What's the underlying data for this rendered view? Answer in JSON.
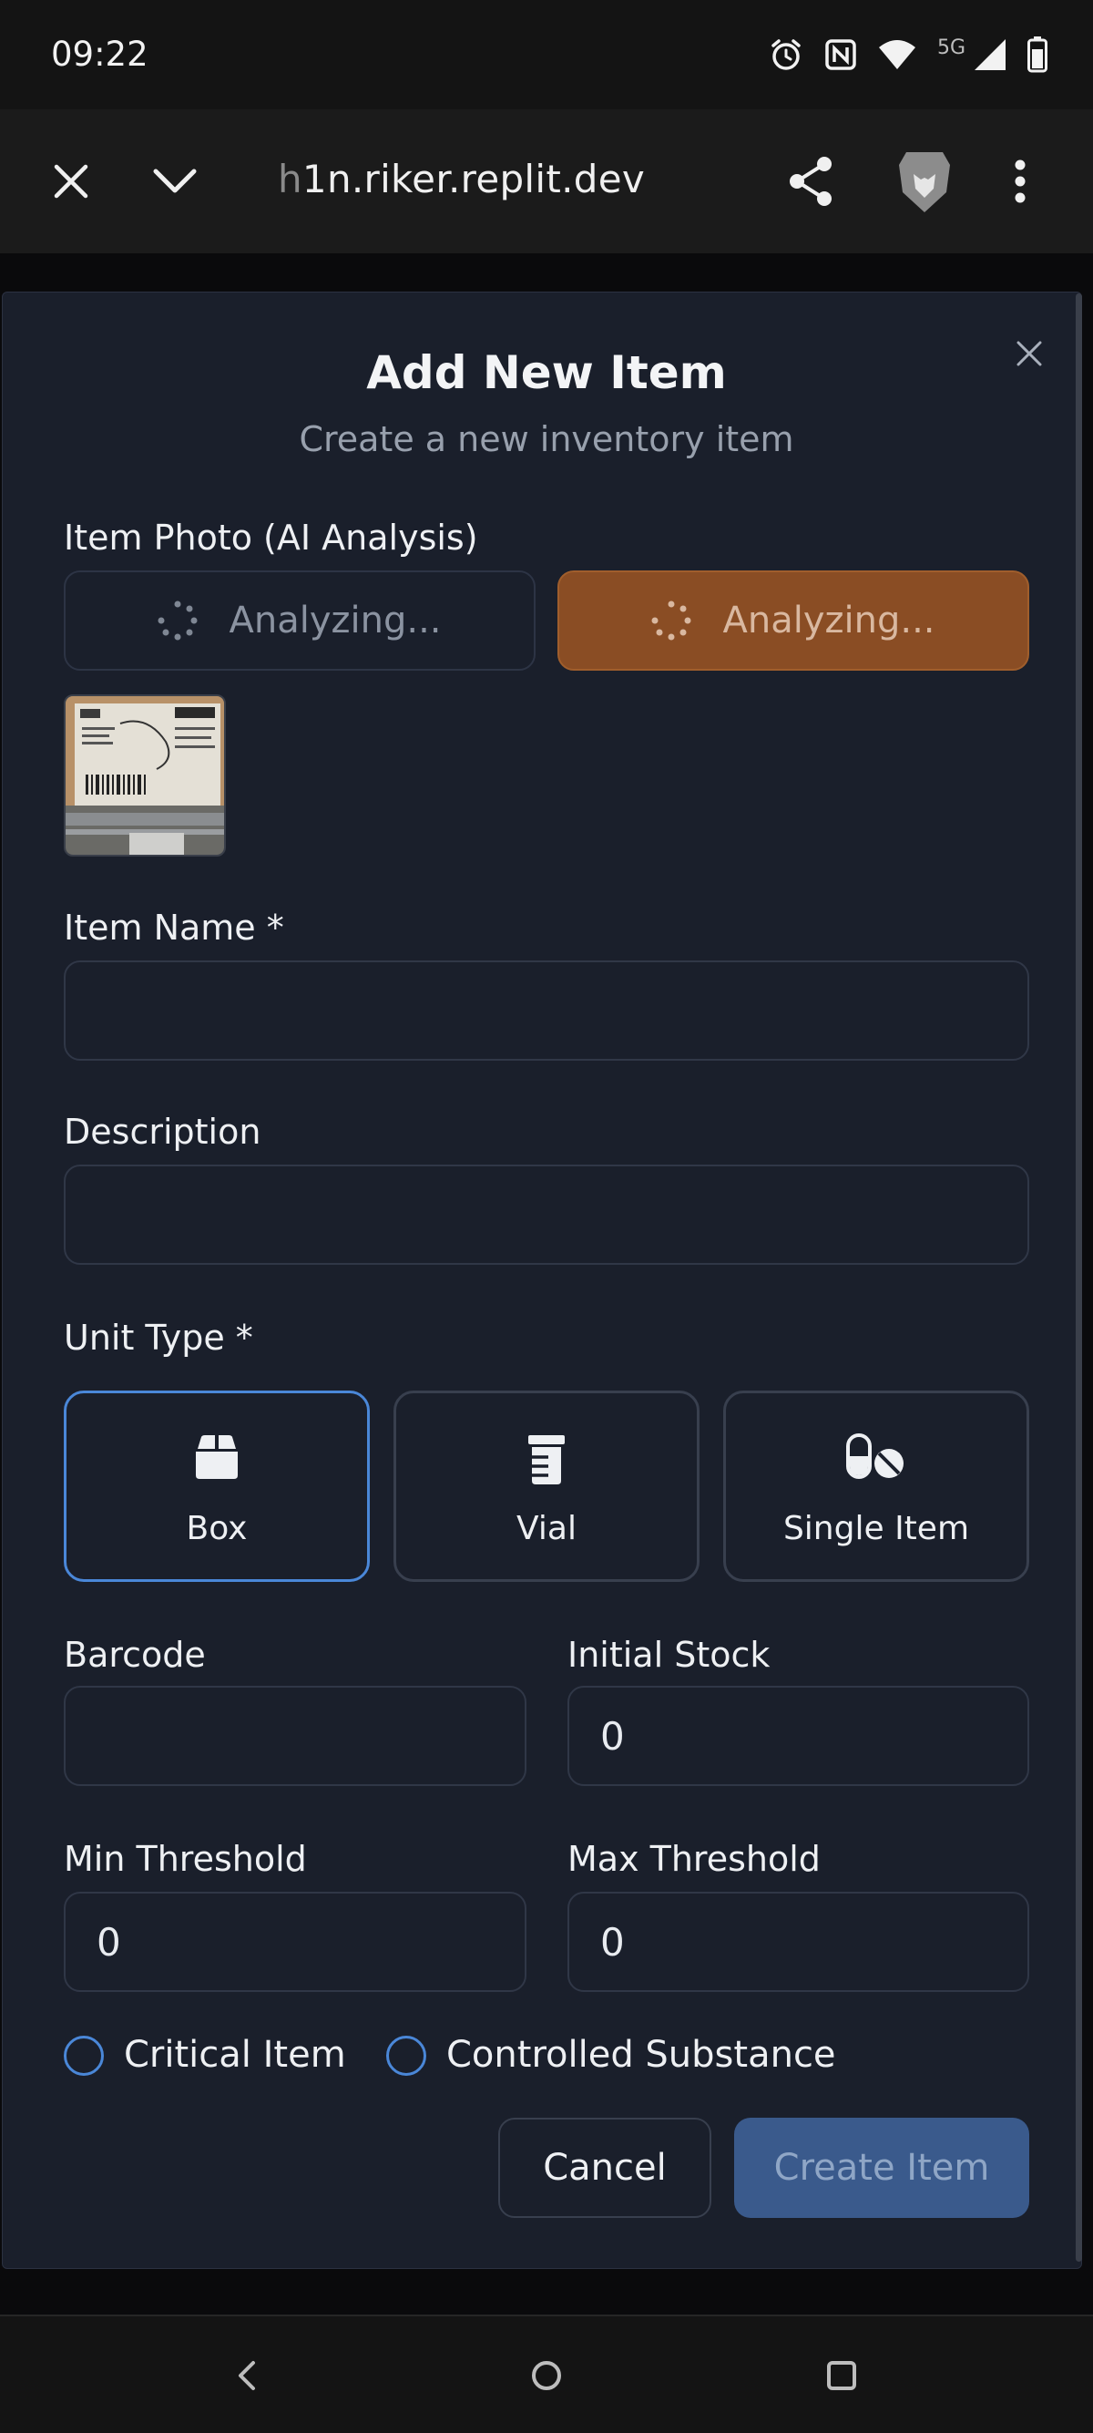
{
  "status_bar": {
    "time": "09:22",
    "network": "5G",
    "icons": [
      "alarm-icon",
      "nfc-icon",
      "wifi-icon",
      "signal-icon",
      "battery-icon"
    ]
  },
  "browser": {
    "url_faded": "h",
    "url_main": "1n.riker.replit.dev",
    "icons": [
      "close-icon",
      "chevron-down-icon",
      "share-icon",
      "brave-lion-icon",
      "more-vert-icon"
    ]
  },
  "modal": {
    "title": "Add New Item",
    "subtitle": "Create a new inventory item"
  },
  "photo": {
    "label": "Item Photo (AI Analysis)",
    "left_button": "Analyzing...",
    "right_button": "Analyzing..."
  },
  "form": {
    "item_name_label": "Item Name *",
    "item_name_value": "",
    "description_label": "Description",
    "description_value": "",
    "unit_type_label": "Unit Type *",
    "unit_types": [
      {
        "label": "Box",
        "icon": "box-icon",
        "selected": true
      },
      {
        "label": "Vial",
        "icon": "vial-icon",
        "selected": false
      },
      {
        "label": "Single Item",
        "icon": "pills-icon",
        "selected": false
      }
    ],
    "barcode_label": "Barcode",
    "barcode_value": "",
    "initial_stock_label": "Initial Stock",
    "initial_stock_value": "0",
    "min_threshold_label": "Min Threshold",
    "min_threshold_value": "0",
    "max_threshold_label": "Max Threshold",
    "max_threshold_value": "0",
    "critical_label": "Critical Item",
    "controlled_label": "Controlled Substance"
  },
  "actions": {
    "cancel": "Cancel",
    "create": "Create Item"
  },
  "colors": {
    "accent": "#4a87d8",
    "orange_button": "#8a4d24",
    "modal_bg": "#1a1f2b",
    "create_button": "#3a5a8c"
  }
}
